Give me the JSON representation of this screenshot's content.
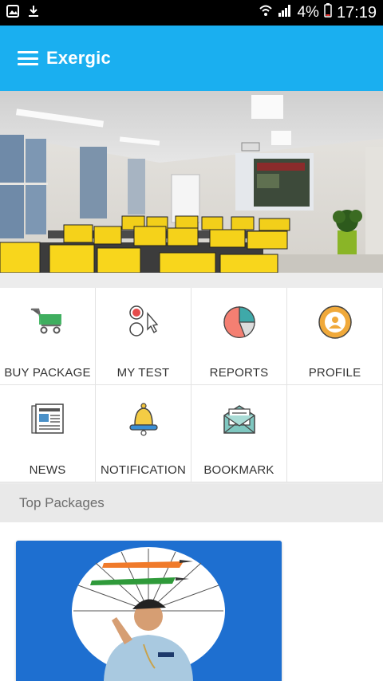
{
  "status_bar": {
    "battery_percent": "4%",
    "time": "17:19",
    "icons": [
      "image-icon",
      "download-icon",
      "wifi-icon",
      "signal-icon",
      "battery-icon"
    ]
  },
  "app_bar": {
    "title": "Exergic",
    "menu_icon": "hamburger-menu-icon",
    "background": "#1aaff0"
  },
  "menu": [
    {
      "label": "BUY PACKAGE",
      "icon": "cart-icon"
    },
    {
      "label": "MY TEST",
      "icon": "test-icon"
    },
    {
      "label": "REPORTS",
      "icon": "pie-chart-icon"
    },
    {
      "label": "PROFILE",
      "icon": "profile-icon"
    },
    {
      "label": "NEWS",
      "icon": "newspaper-icon"
    },
    {
      "label": "NOTIFICATION",
      "icon": "bell-icon"
    },
    {
      "label": "BOOKMARK",
      "icon": "envelope-icon"
    }
  ],
  "top_packages": {
    "title": "Top Packages",
    "card_background": "#1e6fd0"
  }
}
